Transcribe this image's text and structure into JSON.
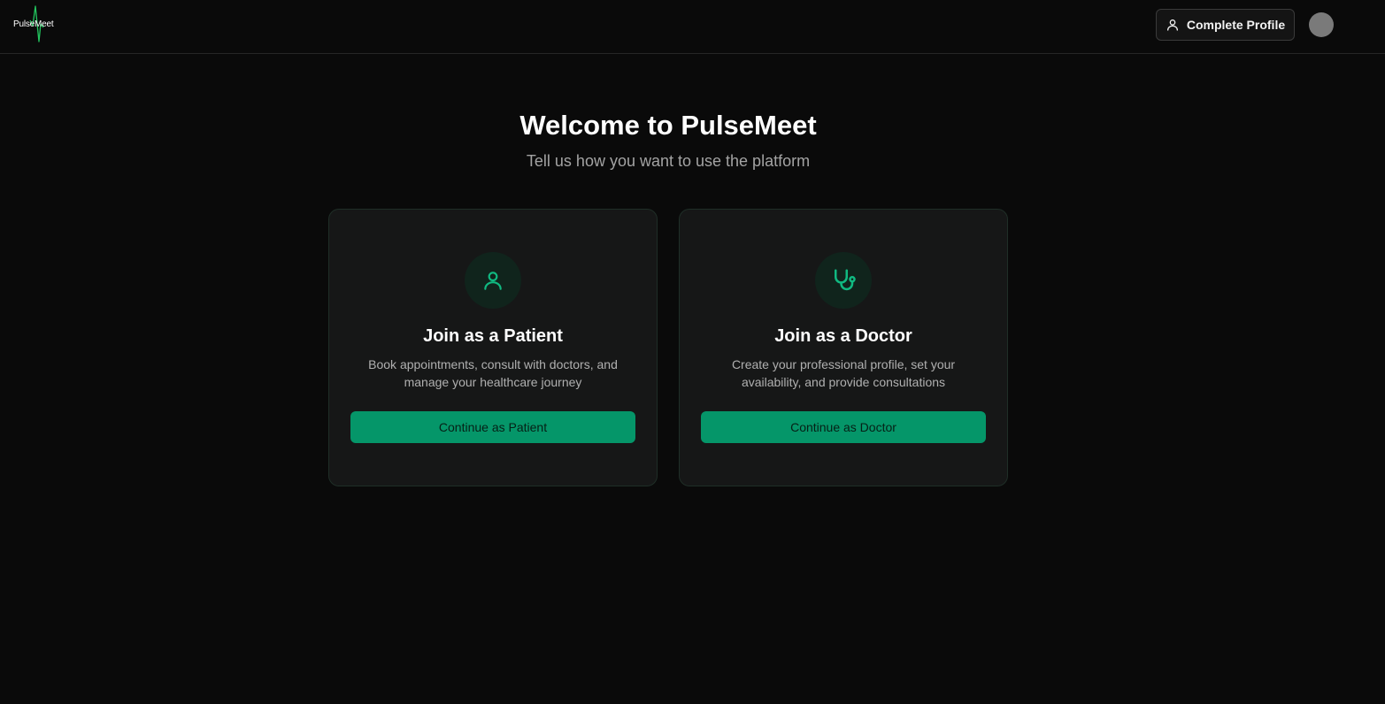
{
  "header": {
    "logo_text": "PulseMeet",
    "complete_profile_label": "Complete Profile"
  },
  "main": {
    "title": "Welcome to PulseMeet",
    "subtitle": "Tell us how you want to use the platform"
  },
  "cards": {
    "patient": {
      "title": "Join as a Patient",
      "description": "Book appointments, consult with doctors, and manage your healthcare journey",
      "button_label": "Continue as Patient",
      "icon": "user-icon"
    },
    "doctor": {
      "title": "Join as a Doctor",
      "description": "Create your professional profile, set your availability, and provide consultations",
      "button_label": "Continue as Doctor",
      "icon": "stethoscope-icon"
    }
  },
  "colors": {
    "background": "#0a0a0a",
    "accent": "#059669",
    "icon_green": "#10b981",
    "card_bg": "#161717"
  }
}
